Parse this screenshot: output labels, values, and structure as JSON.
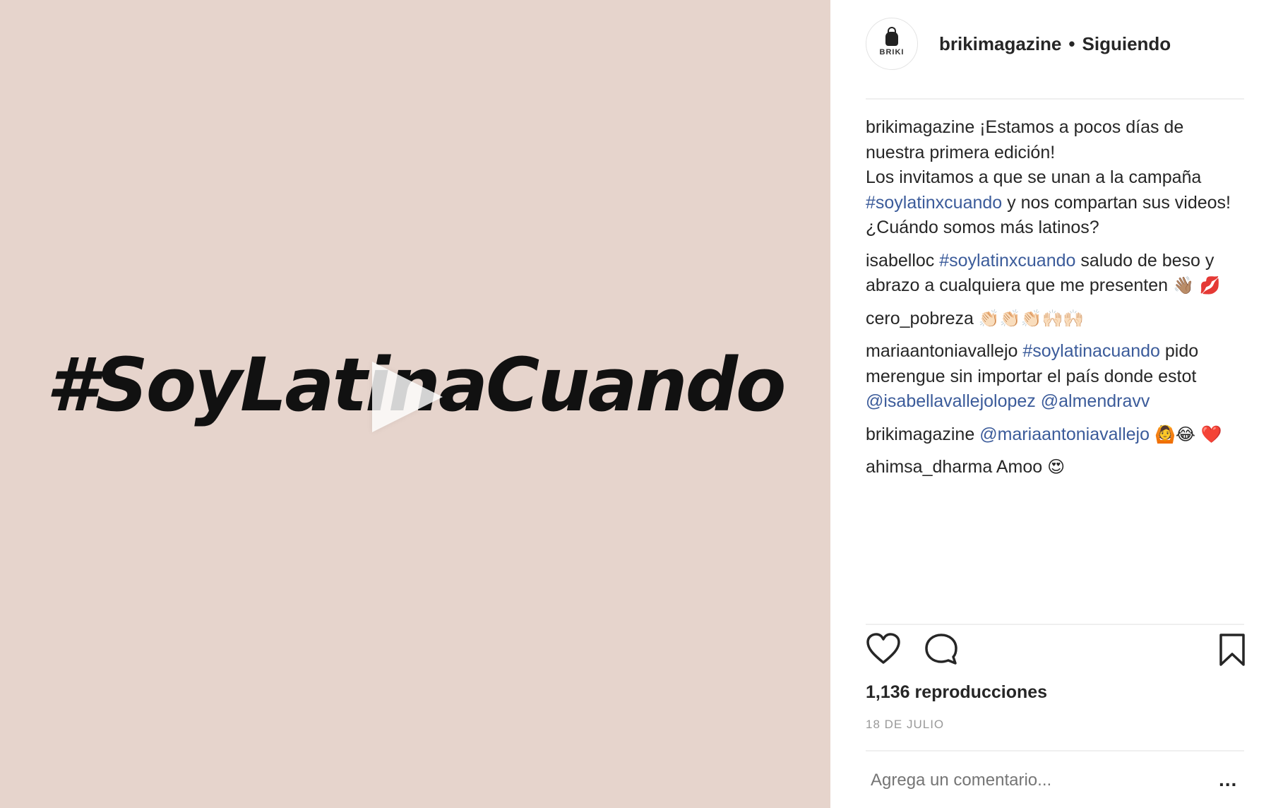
{
  "media": {
    "overlay_text": "#SoyLatinaCuando"
  },
  "header": {
    "avatar_text": "BRIKI",
    "username": "brikimagazine",
    "separator": "•",
    "follow_status": "Siguiendo"
  },
  "comments": [
    {
      "user": "brikimagazine",
      "parts": [
        {
          "t": "text",
          "v": " ¡Estamos a pocos días de nuestra primera edición!"
        },
        {
          "t": "text",
          "v": "\nLos invitamos a que se unan a la campaña "
        },
        {
          "t": "tag",
          "v": "#soylatinxcuando"
        },
        {
          "t": "text",
          "v": " y nos compartan sus videos! ¿Cuándo somos más latinos?"
        }
      ]
    },
    {
      "user": "isabelloc",
      "parts": [
        {
          "t": "text",
          "v": " "
        },
        {
          "t": "tag",
          "v": "#soylatinxcuando"
        },
        {
          "t": "text",
          "v": " saludo de beso y abrazo a cualquiera que me presenten "
        },
        {
          "t": "emoji",
          "v": "👋🏽 💋"
        }
      ]
    },
    {
      "user": "cero_pobreza",
      "parts": [
        {
          "t": "text",
          "v": " "
        },
        {
          "t": "emoji",
          "v": "👏🏻👏🏻👏🏻🙌🏻🙌🏻"
        }
      ]
    },
    {
      "user": "mariaantoniavallejo",
      "parts": [
        {
          "t": "text",
          "v": " "
        },
        {
          "t": "tag",
          "v": "#soylatinacuando"
        },
        {
          "t": "text",
          "v": " pido merengue sin importar el país donde estot "
        },
        {
          "t": "tag",
          "v": "@isabellavallejolopez"
        },
        {
          "t": "text",
          "v": " "
        },
        {
          "t": "tag",
          "v": "@almendravv"
        }
      ]
    },
    {
      "user": "brikimagazine",
      "parts": [
        {
          "t": "text",
          "v": " "
        },
        {
          "t": "tag",
          "v": "@mariaantoniavallejo"
        },
        {
          "t": "text",
          "v": " "
        },
        {
          "t": "emoji",
          "v": "🙆😂 ❤️"
        }
      ]
    },
    {
      "user": "ahimsa_dharma",
      "parts": [
        {
          "t": "text",
          "v": " Amoo "
        },
        {
          "t": "emoji",
          "v": "😍"
        }
      ]
    }
  ],
  "actions": {
    "like_icon": "heart-outline-icon",
    "comment_icon": "speech-bubble-icon",
    "save_icon": "bookmark-icon"
  },
  "stats": {
    "views": "1,136 reproducciones",
    "date": "18 DE JULIO"
  },
  "comment_box": {
    "placeholder": "Agrega un comentario...",
    "more": "..."
  },
  "colors": {
    "media_bg": "#e6d4cc",
    "link": "#3b5b9a",
    "muted": "#999999"
  }
}
